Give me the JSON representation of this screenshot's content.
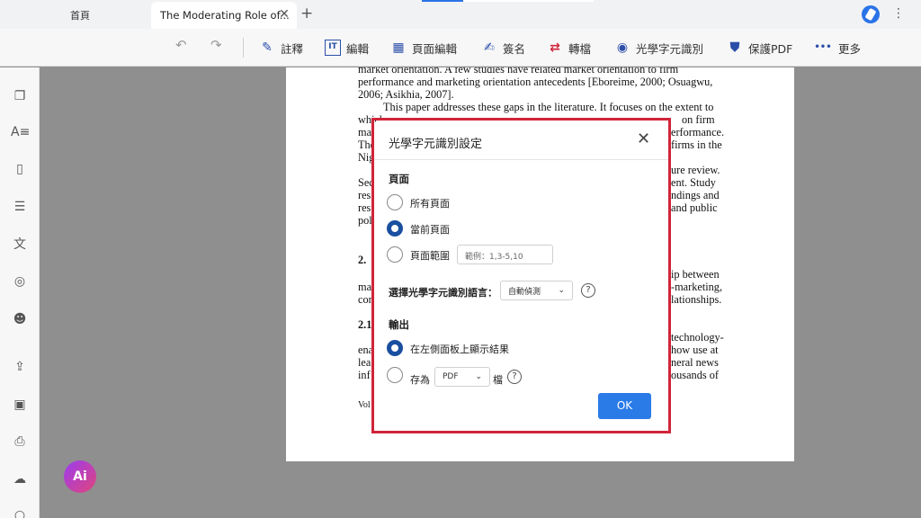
{
  "tabs": {
    "home_label": "首頁",
    "active_title": "The Moderating Role of...",
    "close_glyph": "✕",
    "add_glyph": "+"
  },
  "toolbar": {
    "undo_glyph": "↶",
    "redo_glyph": "↷",
    "items": [
      {
        "label": "註釋",
        "icon": "pen-icon",
        "glyph": "✎"
      },
      {
        "label": "編輯",
        "icon": "text-edit-icon",
        "glyph": "IT"
      },
      {
        "label": "頁面編輯",
        "icon": "page-grid-icon",
        "glyph": "▦"
      },
      {
        "label": "簽名",
        "icon": "signature-icon",
        "glyph": "✍"
      },
      {
        "label": "轉檔",
        "icon": "convert-icon",
        "glyph": "⇄"
      },
      {
        "label": "光學字元識別",
        "icon": "ocr-icon",
        "glyph": "◉"
      },
      {
        "label": "保護PDF",
        "icon": "shield-icon",
        "glyph": "⛊"
      },
      {
        "label": "更多",
        "icon": "more-dots-icon",
        "glyph": "•••"
      }
    ]
  },
  "document_lines": [
    "market orientation. A few studies have related market orientation to firm",
    "performance and marketing orientation antecedents [Eboreime, 2000; Osuagwu,",
    "2006; Asikhia, 2007].",
    "This paper addresses these gaps in the literature. It focuses on the extent to",
    "which",
    "ma",
    "The",
    "Nig",
    "Sec",
    "res",
    "res",
    "pol",
    "2.",
    "ma",
    "cor",
    "2.1",
    "ena",
    "lea",
    "inf",
    "Vol",
    "on firm",
    "erformance.",
    "firms in the",
    "ure review.",
    "ent. Study",
    "ndings and",
    "and public",
    "ip between",
    "-marketing,",
    "lationships.",
    "technology-",
    "how use at",
    "neral news",
    "ousands of"
  ],
  "dialog": {
    "title": "光學字元識別設定",
    "close_glyph": "✕",
    "pages_section": "頁面",
    "pages_options": [
      {
        "label": "所有頁面",
        "checked": false
      },
      {
        "label": "當前頁面",
        "checked": true
      },
      {
        "label": "頁面範圍",
        "checked": false
      }
    ],
    "range_placeholder": "範例：1,3-5,10",
    "language_label": "選擇光學字元識別語言：",
    "language_value": "自動偵測",
    "help_glyph": "?",
    "output_section": "輸出",
    "output_option_panel": "在左側面板上顯示結果",
    "output_option_save_prefix": "存為",
    "output_format": "PDF",
    "output_option_save_suffix": "檔",
    "output_selected": "panel",
    "ok_label": "OK"
  },
  "ai_button_label": "Ai",
  "colors": {
    "accent": "#2a7be8",
    "highlight_border": "#d0253a",
    "radio_checked": "#1a4fa0"
  }
}
